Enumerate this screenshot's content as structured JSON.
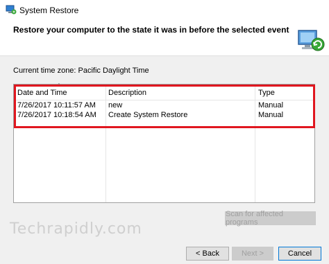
{
  "window": {
    "title": "System Restore"
  },
  "header": {
    "heading": "Restore your computer to the state it was in before the selected event"
  },
  "timezone_label": "Current time zone: Pacific Daylight Time",
  "table": {
    "columns": [
      "Date and Time",
      "Description",
      "Type"
    ],
    "rows": [
      {
        "date": "7/26/2017 10:11:57 AM",
        "description": "new",
        "type": "Manual"
      },
      {
        "date": "7/26/2017 10:18:54 AM",
        "description": "Create System Restore",
        "type": "Manual"
      }
    ]
  },
  "buttons": {
    "scan": "Scan for affected programs",
    "back": "< Back",
    "next": "Next >",
    "cancel": "Cancel"
  },
  "watermark": "Techrapidly.com",
  "colors": {
    "highlight": "#e0161f",
    "accent": "#0078d7"
  }
}
